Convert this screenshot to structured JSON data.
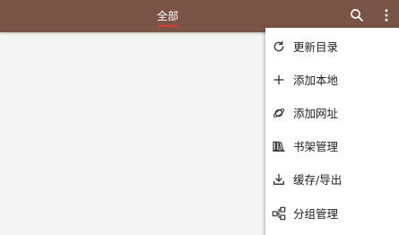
{
  "toolbar": {
    "background": "#7a5547",
    "tab_label": "全部",
    "indicator_color": "#e53935",
    "search_icon": "search-icon",
    "more_icon": "more-vert-icon"
  },
  "menu": {
    "items": [
      {
        "label": "更新目录",
        "icon": "refresh-icon"
      },
      {
        "label": "添加本地",
        "icon": "plus-icon"
      },
      {
        "label": "添加网址",
        "icon": "planet-icon"
      },
      {
        "label": "书架管理",
        "icon": "bookshelf-icon"
      },
      {
        "label": "缓存/导出",
        "icon": "download-icon"
      },
      {
        "label": "分组管理",
        "icon": "group-icon"
      }
    ]
  }
}
